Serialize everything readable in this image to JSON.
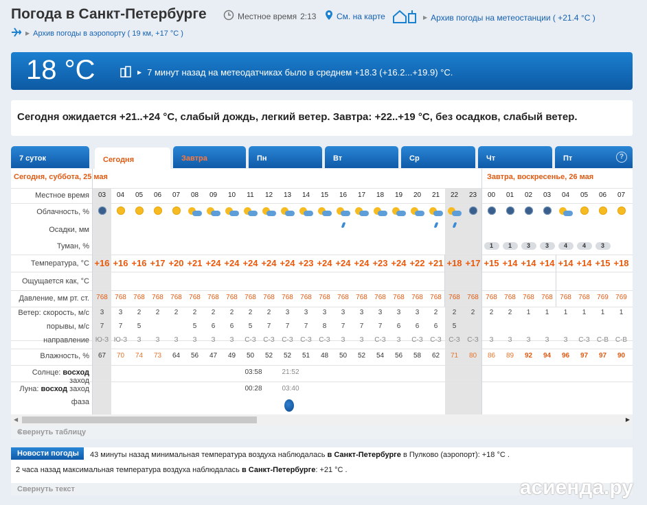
{
  "header": {
    "title": "Погода в Санкт-Петербурге",
    "local_time_label": "Местное время",
    "local_time": "2:13",
    "map_link": "См. на карте",
    "archive_station": "Архив погоды на метеостанции ( +21.4 °C )",
    "archive_airport": "Архив погоды в аэропорту ( 19 км, +17 °C )"
  },
  "current": {
    "temp": "18 °C",
    "sensors_text": "7 минут назад на метеодатчиках было в среднем +18.3 (+16.2...+19.9) °C."
  },
  "forecast_text": "Сегодня ожидается +21..+24 °C, слабый дождь, легкий ветер. Завтра: +22..+19 °C, без осадков, слабый ветер.",
  "tabs": [
    "7 суток",
    "Сегодня",
    "Завтра",
    "Пн",
    "Вт",
    "Ср",
    "Чт",
    "Пт"
  ],
  "help": "?",
  "day_labels": {
    "today": "Сегодня, суббота, 25 мая",
    "tomorrow": "Завтра, воскресенье, 26 мая"
  },
  "row_labels": {
    "time": "Местное время",
    "cloud": "Облачность, %",
    "precip": "Осадки, мм",
    "fog": "Туман, %",
    "temp": "Температура, °C",
    "feels": "Ощущается как, °C",
    "pressure": "Давление, мм рт. ст.",
    "wind": "Ветер: скорость, м/с",
    "gusts": "порывы, м/с",
    "direction": "направление",
    "humidity": "Влажность, %",
    "sun_prefix": "Солнце:",
    "sun_rise": "восход",
    "sun_set": "заход",
    "moon_prefix": "Луна:",
    "moon_rise": "восход",
    "moon_set": "заход",
    "phase": "фаза"
  },
  "hours": [
    "03",
    "04",
    "05",
    "06",
    "07",
    "08",
    "09",
    "10",
    "11",
    "12",
    "13",
    "14",
    "15",
    "16",
    "17",
    "18",
    "19",
    "20",
    "21",
    "22",
    "23",
    "00",
    "01",
    "02",
    "03",
    "04",
    "05",
    "06",
    "07"
  ],
  "cloud_icons": [
    "moon",
    "sun",
    "sun",
    "sun",
    "sun",
    "pc",
    "pc",
    "pc",
    "pc",
    "pc",
    "pc",
    "pc",
    "pc",
    "pc",
    "pc",
    "pc",
    "pc",
    "pc",
    "pc",
    "pc",
    "moon",
    "moon",
    "moon",
    "moon",
    "moon",
    "pc",
    "sun",
    "sun",
    "sun"
  ],
  "rain_cols": [
    13,
    18,
    19
  ],
  "fog": [
    "",
    "",
    "",
    "",
    "",
    "",
    "",
    "",
    "",
    "",
    "",
    "",
    "",
    "",
    "",
    "",
    "",
    "",
    "",
    "",
    "",
    "1",
    "1",
    "3",
    "3",
    "4",
    "4",
    "3",
    ""
  ],
  "temperature": [
    "+16",
    "+16",
    "+16",
    "+17",
    "+20",
    "+21",
    "+24",
    "+24",
    "+24",
    "+24",
    "+24",
    "+23",
    "+24",
    "+24",
    "+24",
    "+23",
    "+24",
    "+22",
    "+21",
    "+18",
    "+17",
    "+15",
    "+14",
    "+14",
    "+14",
    "+14",
    "+14",
    "+15",
    "+18"
  ],
  "pressure": [
    "768",
    "768",
    "768",
    "768",
    "768",
    "768",
    "768",
    "768",
    "768",
    "768",
    "768",
    "768",
    "768",
    "768",
    "768",
    "768",
    "768",
    "768",
    "768",
    "768",
    "768",
    "768",
    "768",
    "768",
    "768",
    "768",
    "768",
    "769",
    "769"
  ],
  "wind": [
    "3",
    "3",
    "2",
    "2",
    "2",
    "2",
    "2",
    "2",
    "2",
    "2",
    "3",
    "3",
    "3",
    "3",
    "3",
    "3",
    "3",
    "3",
    "2",
    "2",
    "2",
    "2",
    "2",
    "1",
    "1",
    "1",
    "1",
    "1",
    "1"
  ],
  "gusts": [
    "7",
    "7",
    "5",
    "",
    "",
    "5",
    "6",
    "6",
    "5",
    "7",
    "7",
    "7",
    "8",
    "7",
    "7",
    "7",
    "6",
    "6",
    "6",
    "5",
    "",
    "",
    "",
    "",
    "",
    "",
    "",
    "",
    ""
  ],
  "direction": [
    "Ю-З",
    "Ю-З",
    "З",
    "З",
    "З",
    "З",
    "З",
    "З",
    "С-З",
    "С-З",
    "С-З",
    "С-З",
    "С-З",
    "З",
    "З",
    "С-З",
    "З",
    "С-З",
    "С-З",
    "С-З",
    "С-З",
    "З",
    "З",
    "З",
    "З",
    "З",
    "С-З",
    "С-В",
    "С-В"
  ],
  "humidity": [
    "67",
    "70",
    "74",
    "73",
    "64",
    "56",
    "47",
    "49",
    "50",
    "52",
    "52",
    "51",
    "48",
    "50",
    "52",
    "54",
    "56",
    "58",
    "62",
    "71",
    "80",
    "86",
    "89",
    "92",
    "94",
    "96",
    "97",
    "97",
    "90"
  ],
  "sun": {
    "rise": "03:58",
    "set": "21:52"
  },
  "moon": {
    "rise": "00:28",
    "set": "03:40"
  },
  "collapse_table": "Свернуть таблицу",
  "news": {
    "label": "Новости погоды",
    "line1_pre": "43 минуты назад минимальная температура воздуха наблюдалась",
    "line1_city": "в Санкт-Петербурге",
    "line1_post": "в Пулково (аэропорт): +18 °C .",
    "line2_pre": "2 часа назад максимальная температура воздуха наблюдалась",
    "line2_city": "в Санкт-Петербурге",
    "line2_post": ": +21 °C ."
  },
  "collapse_text": "Свернуть текст",
  "watermark": "асиенда.ру",
  "colors": {
    "accent": "#1560b0",
    "band": "#0d5aa3",
    "temp": "#e8590c"
  }
}
